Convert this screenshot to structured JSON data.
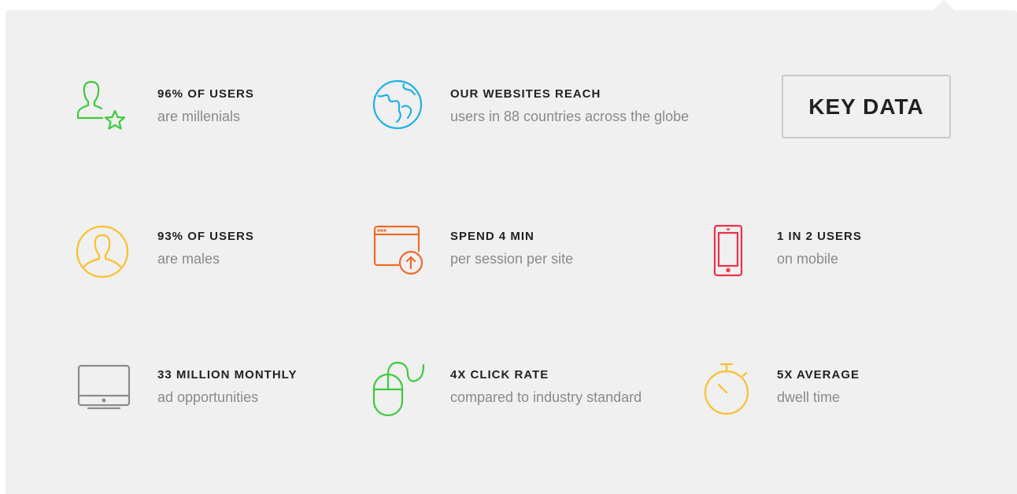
{
  "key_data_label": "KEY DATA",
  "colors": {
    "green": "#3ec93e",
    "blue": "#21b0e6",
    "yellow": "#fbbe2e",
    "orange": "#f06a28",
    "red": "#e8334a",
    "gray": "#8c8c8c",
    "panel": "#f0f0f0",
    "title": "#222222",
    "subtitle": "#8a8a8a"
  },
  "stats": [
    {
      "icon": "user-star-icon",
      "title": "96% OF USERS",
      "subtitle": "are millenials"
    },
    {
      "icon": "globe-icon",
      "title": "OUR WEBSITES REACH",
      "subtitle": "users in 88 countries across the globe"
    },
    {
      "icon": "user-circle-icon",
      "title": "93% OF USERS",
      "subtitle": "are males"
    },
    {
      "icon": "browser-upload-icon",
      "title": "SPEND 4 MIN",
      "subtitle": "per session per site"
    },
    {
      "icon": "tablet-icon",
      "title": "1 IN 2 USERS",
      "subtitle": "on mobile"
    },
    {
      "icon": "monitor-icon",
      "title": "33 MILLION MONTHLY",
      "subtitle": "ad opportunities"
    },
    {
      "icon": "mouse-icon",
      "title": "4X CLICK RATE",
      "subtitle": "compared to industry standard"
    },
    {
      "icon": "stopwatch-icon",
      "title": "5X AVERAGE",
      "subtitle": "dwell time"
    }
  ]
}
